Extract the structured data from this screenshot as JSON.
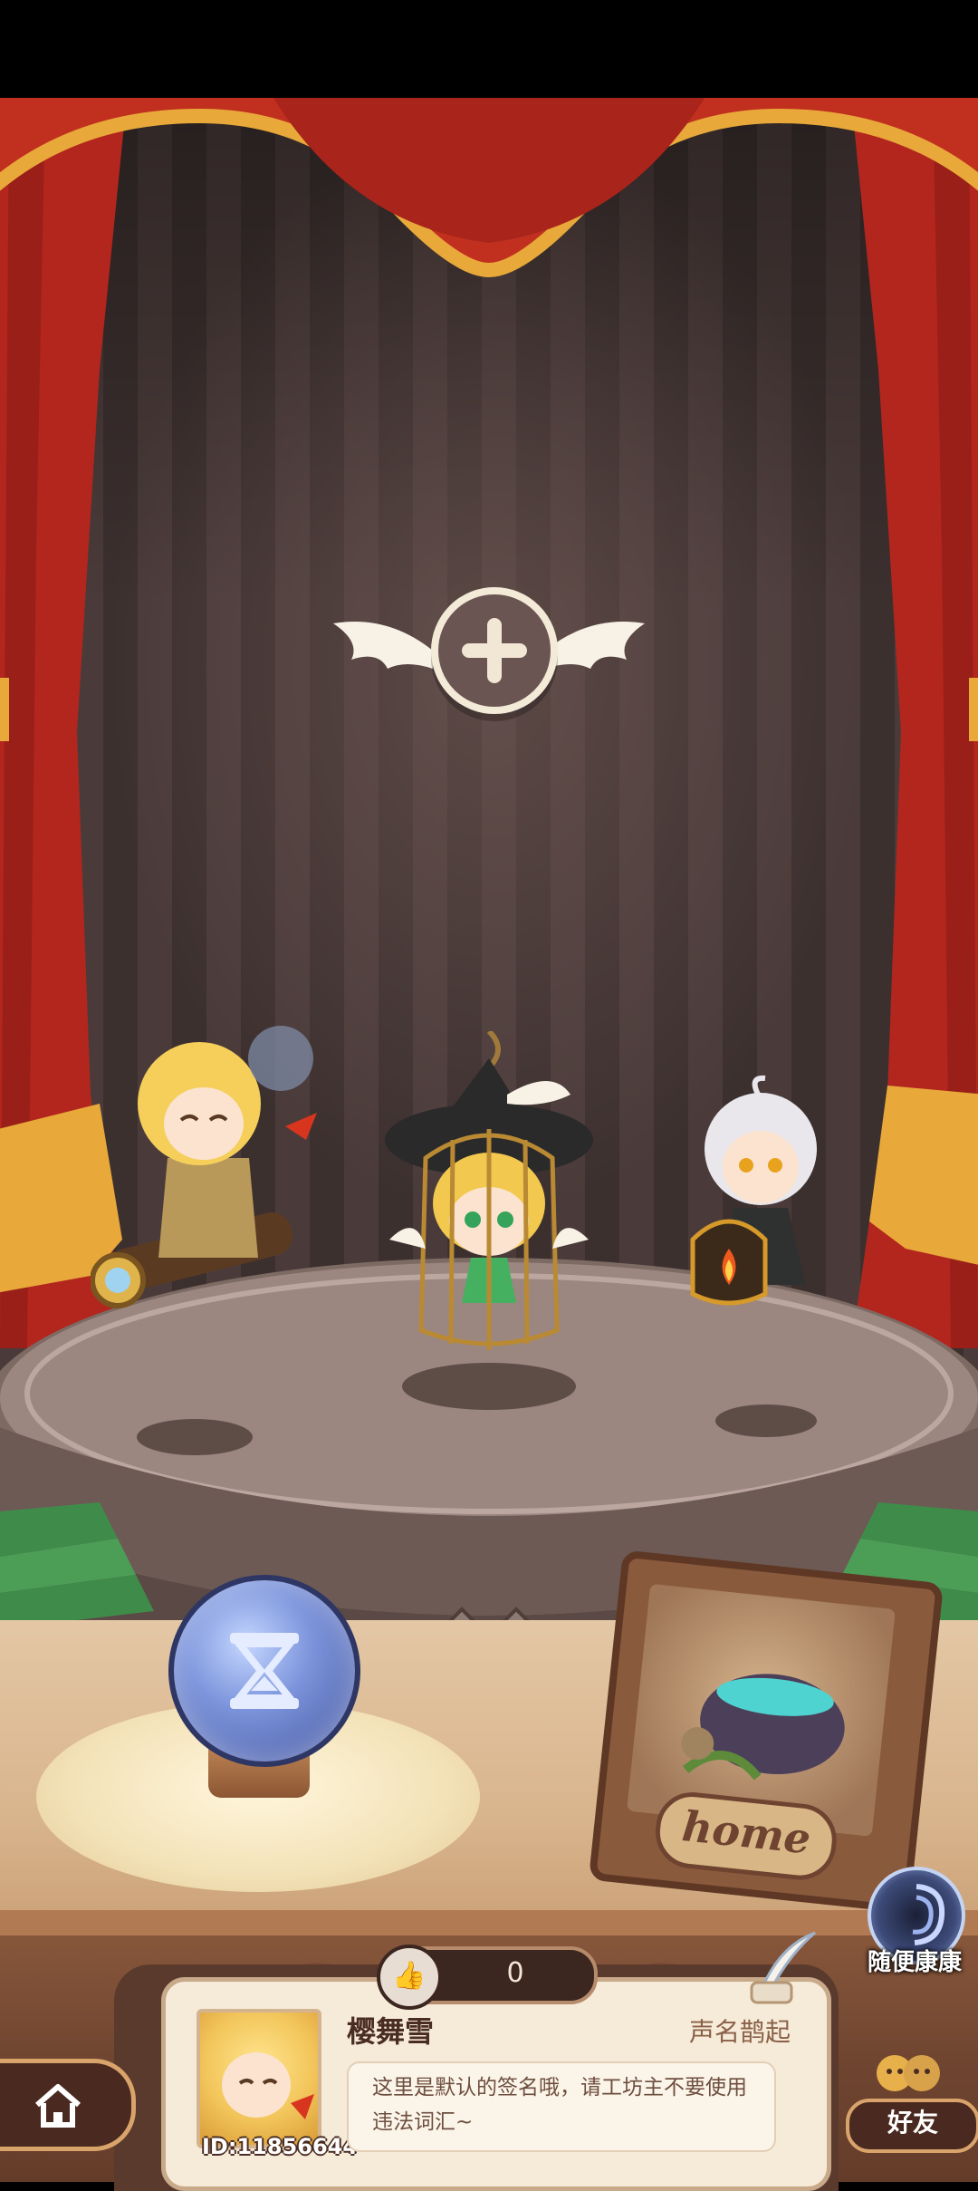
{
  "stage": {
    "add_slot_label": "add-character-slot"
  },
  "home_sign": {
    "label": "home"
  },
  "side_buttons": {
    "random_kangkang_label": "随便康康",
    "friends_label": "好友"
  },
  "likes": {
    "count": "0"
  },
  "profile": {
    "username": "樱舞雪",
    "reputation_title": "声名鹊起",
    "user_id": "ID:11856644",
    "signature": "这里是默认的签名哦，请工坊主不要使用违法词汇~"
  },
  "icons": {
    "add": "plus-icon",
    "hourglass": "hourglass-icon",
    "portal": "portal-icon",
    "like": "thumbs-up-icon",
    "home": "home-icon",
    "friends": "friends-icon",
    "quill": "quill-icon"
  },
  "colors": {
    "curtain_red": "#b3261e",
    "curtain_gold": "#e8a93a",
    "stage_floor": "#8d7870",
    "wood_dark": "#4a2a20",
    "card_bg": "#f6ebd8"
  }
}
